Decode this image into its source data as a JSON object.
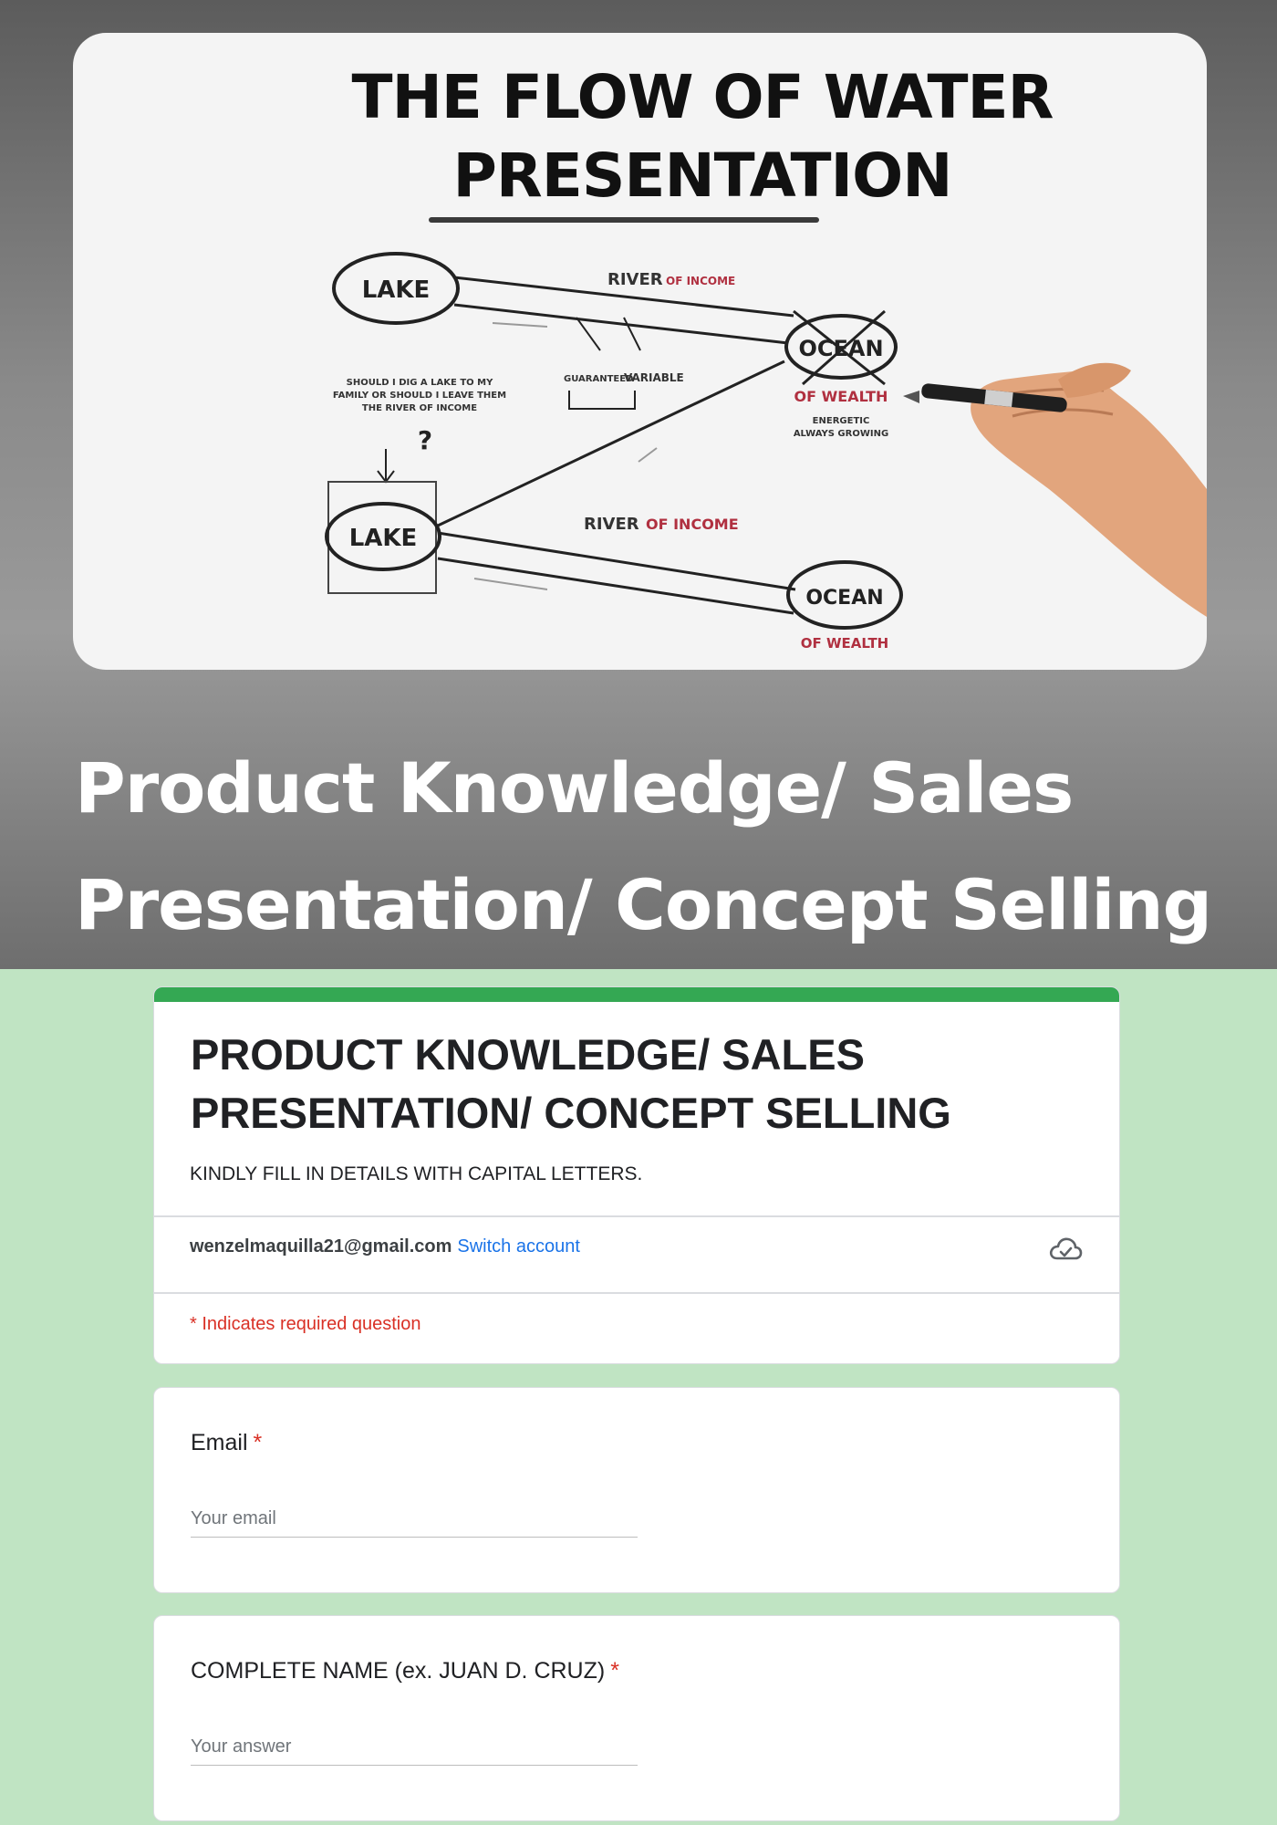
{
  "banner": {
    "image_title_line1": "THE FLOW OF WATER",
    "image_title_line2": "PRESENTATION",
    "diagram": {
      "lake_top": "LAKE",
      "lake_bottom": "LAKE",
      "river_top": "RIVER",
      "river_top_sub": "OF INCOME",
      "river_bottom": "RIVER",
      "river_bottom_sub": "OF INCOME",
      "ocean_top": "OCEAN",
      "ocean_top_sub": "OF WEALTH",
      "ocean_top_note_1": "ENERGETIC",
      "ocean_top_note_2": "ALWAYS GROWING",
      "ocean_bottom": "OCEAN",
      "ocean_bottom_sub": "OF WEALTH",
      "guaranteed": "GUARANTEED",
      "variable": "VARIABLE",
      "question_line1": "SHOULD I DIG A LAKE TO MY",
      "question_line2": "FAMILY OR SHOULD I LEAVE THEM",
      "question_line3": "THE RIVER OF INCOME",
      "question_mark": "?"
    },
    "heading_line1": "Product Knowledge/ Sales",
    "heading_line2": "Presentation/ Concept Selling"
  },
  "form": {
    "accent_color": "#34a853",
    "title_line1": "PRODUCT KNOWLEDGE/ SALES",
    "title_line2": "PRESENTATION/ CONCEPT SELLING",
    "description": "KINDLY FILL IN DETAILS WITH CAPITAL LETTERS.",
    "account_email": "wenzelmaquilla21@gmail.com",
    "switch_account": "Switch account",
    "cloud_icon": "cloud-saved-icon",
    "required_note": "* Indicates required question",
    "questions": [
      {
        "label": "Email",
        "required_mark": "*",
        "placeholder": "Your email",
        "value": ""
      },
      {
        "label": "COMPLETE NAME (ex. JUAN D. CRUZ)",
        "required_mark": "*",
        "placeholder": "Your answer",
        "value": ""
      }
    ]
  }
}
